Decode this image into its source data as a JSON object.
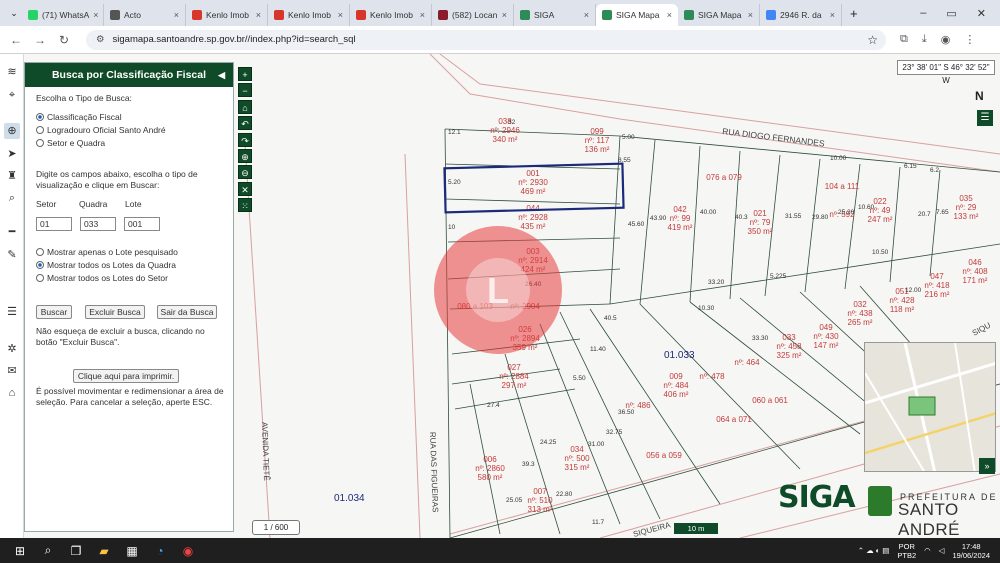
{
  "browser": {
    "tabs": [
      {
        "title": "(71) WhatsA",
        "color": "#25d366"
      },
      {
        "title": "Acto",
        "color": "#555555"
      },
      {
        "title": "Kenlo Imob",
        "color": "#d9362b"
      },
      {
        "title": "Kenlo Imob",
        "color": "#d9362b"
      },
      {
        "title": "Kenlo Imob",
        "color": "#d9362b"
      },
      {
        "title": "(582) Locan",
        "color": "#8a1c2b"
      },
      {
        "title": "SIGA",
        "color": "#2e8b57"
      },
      {
        "title": "SIGA Mapa",
        "color": "#2e8b57"
      },
      {
        "title": "SIGA Mapa",
        "color": "#2e8b57"
      },
      {
        "title": "2946 R. da",
        "color": "#4285f4"
      }
    ],
    "active_tab": 7,
    "url": "sigamapa.santoandre.sp.gov.br//index.php?id=search_sql"
  },
  "panel": {
    "title": "Busca por Classificação Fiscal",
    "choose_label": "Escolha o Tipo de Busca:",
    "search_types": [
      "Classificação Fiscal",
      "Logradouro Oficial Santo André",
      "Setor e Quadra"
    ],
    "selected_type": 0,
    "instructions_1": "Digite os campos abaixo, escolha o tipo de",
    "instructions_2": "visualização e clique em Buscar:",
    "field_labels": [
      "Setor",
      "Quadra",
      "Lote"
    ],
    "field_values": [
      "01",
      "033",
      "001"
    ],
    "view_options": [
      "Mostrar apenas o Lote pesquisado",
      "Mostrar todos os Lotes da Quadra",
      "Mostrar todos os Lotes do Setor"
    ],
    "selected_view": 1,
    "buttons": [
      "Buscar",
      "Excluir Busca",
      "Sair da Busca"
    ],
    "note_1": "Não esqueça de excluir a busca, clicando no",
    "note_2": "botão \"Excluir Busca\".",
    "print_button": "Clique aqui para imprimir.",
    "move_note_1": "É possível movimentar e redimensionar a área de",
    "move_note_2": "seleção. Para cancelar a seleção, aperte ESC."
  },
  "map": {
    "coordinates": "23° 38' 01\" S 46° 32' 52\" W",
    "north": "N",
    "page_counter": "1 / 600",
    "scale": "10 m",
    "streets": [
      "RUA DIOGO FERNANDES",
      "AVENIDA TIETÊ",
      "RUA DAS FIGUEIRAS",
      "SIQUEIRA",
      "SIQU"
    ],
    "blocks": [
      "01.033",
      "01.034"
    ],
    "lots": [
      {
        "code": "038",
        "num": "nº: 2946",
        "area": "340 m²"
      },
      {
        "code": "099",
        "num": "nº: 117",
        "area": "136 m²"
      },
      {
        "code": "001",
        "num": "nº: 2930",
        "area": "469 m²"
      },
      {
        "code": "044",
        "num": "nº: 2928",
        "area": "435 m²"
      },
      {
        "code": "003",
        "num": "nº: 2914",
        "area": "424 m²"
      },
      {
        "code": "080 a 103",
        "num": "nº: 2904",
        "area": ""
      },
      {
        "code": "026",
        "num": "nº: 2894",
        "area": "359 m²"
      },
      {
        "code": "027",
        "num": "nº: 2884",
        "area": "297 m²"
      },
      {
        "code": "006",
        "num": "nº: 2860",
        "area": "580 m²"
      },
      {
        "code": "007",
        "num": "nº: 510",
        "area": "313 m²"
      },
      {
        "code": "034",
        "num": "nº: 500",
        "area": "315 m²"
      },
      {
        "code": "042",
        "num": "nº: 99",
        "area": "419 m²"
      },
      {
        "code": "021",
        "num": "nº: 79",
        "area": "350 m²"
      },
      {
        "code": "022",
        "num": "nº: 49",
        "area": "247 m²"
      },
      {
        "code": "035",
        "num": "nº: 29",
        "area": "133 m²"
      },
      {
        "code": "009",
        "num": "nº: 484",
        "area": "406 m²"
      },
      {
        "code": "033",
        "num": "nº: 458",
        "area": "325 m²"
      },
      {
        "code": "049",
        "num": "nº: 430",
        "area": "147 m²"
      },
      {
        "code": "032",
        "num": "nº: 438",
        "area": "265 m²"
      },
      {
        "code": "051",
        "num": "nº: 428",
        "area": "118 m²"
      },
      {
        "code": "047",
        "num": "nº: 418",
        "area": "216 m²"
      },
      {
        "code": "046",
        "num": "nº: 408",
        "area": "171 m²"
      }
    ],
    "ranges": [
      "076 a 079",
      "104 a 111",
      "060 a 061",
      "064 a 071",
      "056 a 059"
    ],
    "extra_nums": [
      "nº: 478",
      "nº: 486",
      "nº: 464",
      "nº: 592"
    ],
    "dims": [
      "12.1",
      "32",
      "5.00",
      "8.55",
      "10",
      "10.00",
      "6.15",
      "6.2",
      "7.65",
      "25.20",
      "20.7",
      "10.50",
      "5.225",
      "10.30",
      "12.00",
      "11.40",
      "5.50",
      "24.25",
      "36.50",
      "31.00",
      "32.75",
      "25.05",
      "22.80",
      "11.7",
      "39.3",
      "27.4",
      "31.55",
      "29.80",
      "43.90",
      "45.60",
      "40.00",
      "40.3",
      "33.30",
      "33.20",
      "10.60",
      "26.40",
      "40.5",
      "5.20"
    ]
  },
  "logo": {
    "siga": "SIGA",
    "prefeitura": "PREFEITURA DE",
    "city": "SANTO ANDRÉ"
  },
  "taskbar": {
    "lang": "POR",
    "layout": "PTB2",
    "time": "17:48",
    "date": "19/06/2024"
  }
}
